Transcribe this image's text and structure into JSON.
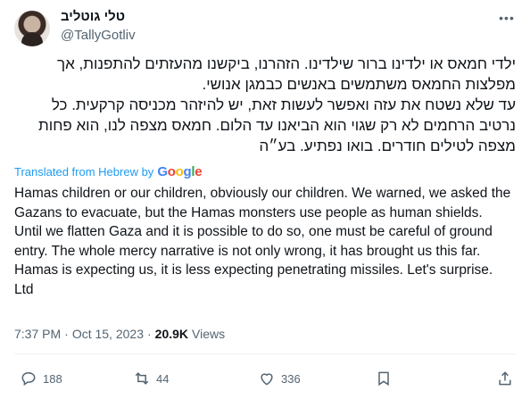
{
  "author": {
    "display_name": "טלי גוטליב",
    "handle": "@TallyGotliv"
  },
  "tweet": {
    "hebrew_text": "ילדי חמאס או ילדינו ברור שילדינו. הזהרנו, ביקשנו מהעזתים להתפנות, אך\nמפלצות החמאס משתמשים באנשים כבמגן אנושי.\nעד שלא נשטח את עזה ואפשר לעשות זאת, יש להיזהר מכניסה קרקעית. כל\nנרטיב הרחמים לא רק שגוי הוא הביאנו עד הלום. חמאס מצפה לנו, הוא פחות\nמצפה לטילים חודרים. בואו נפתיע. בע״ה",
    "translated_label": "Translated from Hebrew by",
    "translator_brand": "Google",
    "translation": "Hamas children or our children, obviously our children. We warned, we asked the Gazans to evacuate, but the Hamas monsters use people as human shields.\nUntil we flatten Gaza and it is possible to do so, one must be careful of ground entry. The whole mercy narrative is not only wrong, it has brought us this far. Hamas is expecting us, it is less expecting penetrating missiles. Let's surprise. Ltd",
    "time": "7:37 PM",
    "separator": "·",
    "date": "Oct 15, 2023",
    "views_count": "20.9K",
    "views_label": "Views"
  },
  "actions": {
    "replies": "188",
    "reposts": "44",
    "likes": "336"
  },
  "icons": {
    "more": "more-icon",
    "reply": "reply-icon",
    "repost": "repost-icon",
    "like": "heart-icon",
    "bookmark": "bookmark-icon",
    "share": "share-icon"
  },
  "colors": {
    "link": "#1d9bf0",
    "secondary_text": "#536471",
    "primary_text": "#0f1419"
  }
}
